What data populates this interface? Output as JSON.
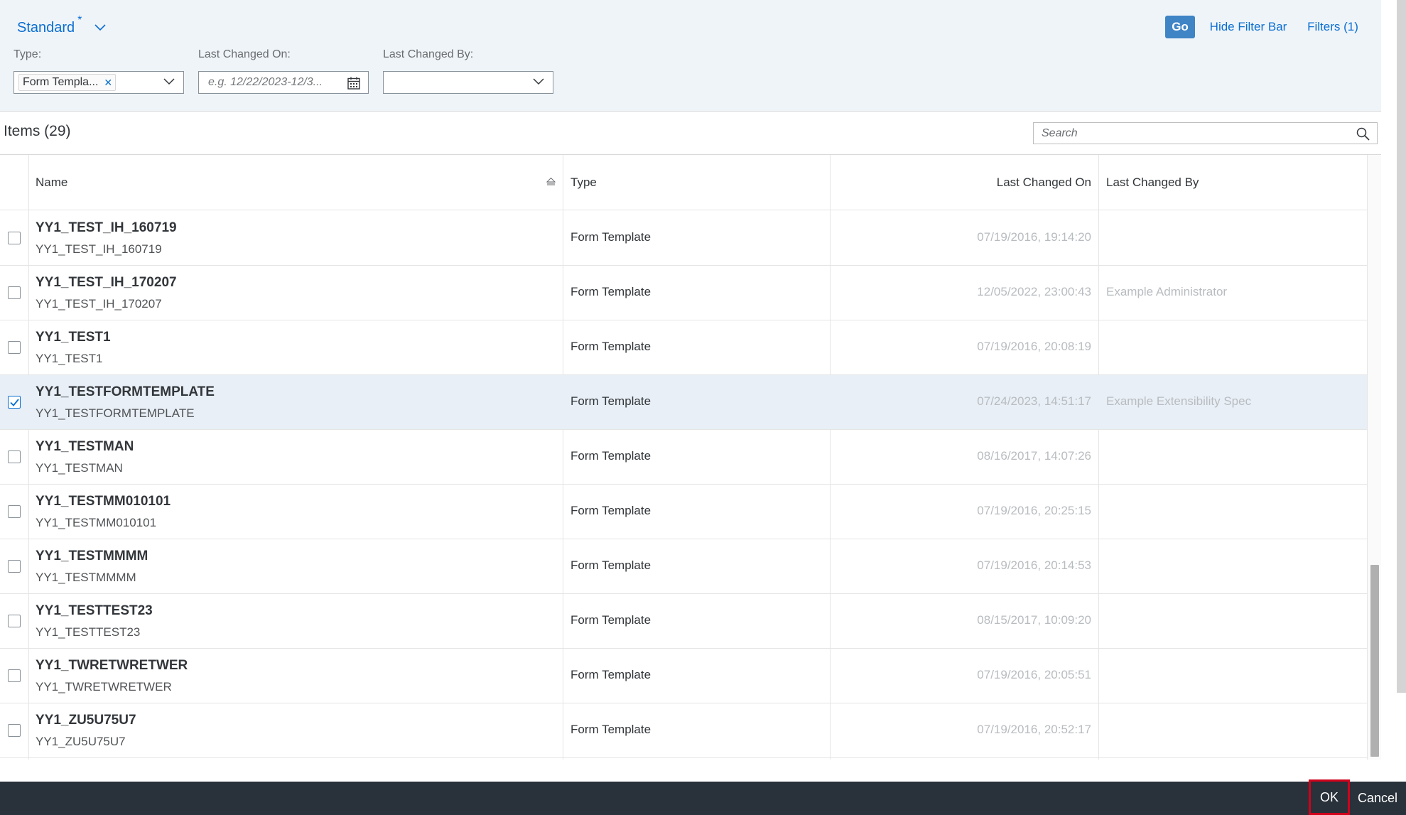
{
  "filter_bar": {
    "variant_title": "Standard",
    "variant_modified_marker": "*",
    "go_label": "Go",
    "hide_filter_bar_label": "Hide Filter Bar",
    "filters_label": "Filters (1)",
    "type_label": "Type:",
    "type_token": "Form Templa...",
    "last_changed_on_label": "Last Changed On:",
    "last_changed_on_placeholder": "e.g. 12/22/2023-12/3...",
    "last_changed_by_label": "Last Changed By:",
    "last_changed_by_value": ""
  },
  "items": {
    "title": "Items (29)",
    "search_placeholder": "Search"
  },
  "table": {
    "columns": {
      "name": "Name",
      "type": "Type",
      "last_changed_on": "Last Changed On",
      "last_changed_by": "Last Changed By"
    },
    "rows": [
      {
        "title": "YY1_TEST_IH_160719",
        "subtitle": "YY1_TEST_IH_160719",
        "type": "Form Template",
        "last_changed_on": "07/19/2016, 19:14:20",
        "last_changed_by": "",
        "selected": false
      },
      {
        "title": "YY1_TEST_IH_170207",
        "subtitle": "YY1_TEST_IH_170207",
        "type": "Form Template",
        "last_changed_on": "12/05/2022, 23:00:43",
        "last_changed_by": "Example Administrator",
        "selected": false
      },
      {
        "title": "YY1_TEST1",
        "subtitle": "YY1_TEST1",
        "type": "Form Template",
        "last_changed_on": "07/19/2016, 20:08:19",
        "last_changed_by": "",
        "selected": false
      },
      {
        "title": "YY1_TESTFORMTEMPLATE",
        "subtitle": "YY1_TESTFORMTEMPLATE",
        "type": "Form Template",
        "last_changed_on": "07/24/2023, 14:51:17",
        "last_changed_by": "Example Extensibility Spec",
        "selected": true
      },
      {
        "title": "YY1_TESTMAN",
        "subtitle": "YY1_TESTMAN",
        "type": "Form Template",
        "last_changed_on": "08/16/2017, 14:07:26",
        "last_changed_by": "",
        "selected": false
      },
      {
        "title": "YY1_TESTMM010101",
        "subtitle": "YY1_TESTMM010101",
        "type": "Form Template",
        "last_changed_on": "07/19/2016, 20:25:15",
        "last_changed_by": "",
        "selected": false
      },
      {
        "title": "YY1_TESTMMMM",
        "subtitle": "YY1_TESTMMMM",
        "type": "Form Template",
        "last_changed_on": "07/19/2016, 20:14:53",
        "last_changed_by": "",
        "selected": false
      },
      {
        "title": "YY1_TESTTEST23",
        "subtitle": "YY1_TESTTEST23",
        "type": "Form Template",
        "last_changed_on": "08/15/2017, 10:09:20",
        "last_changed_by": "",
        "selected": false
      },
      {
        "title": "YY1_TWRETWRETWER",
        "subtitle": "YY1_TWRETWRETWER",
        "type": "Form Template",
        "last_changed_on": "07/19/2016, 20:05:51",
        "last_changed_by": "",
        "selected": false
      },
      {
        "title": "YY1_ZU5U75U7",
        "subtitle": "YY1_ZU5U75U7",
        "type": "Form Template",
        "last_changed_on": "07/19/2016, 20:52:17",
        "last_changed_by": "",
        "selected": false
      }
    ]
  },
  "footer": {
    "ok_label": "OK",
    "cancel_label": "Cancel"
  },
  "colors": {
    "accent": "#0a6ed1",
    "go_button": "#3f84c5",
    "footer_bg": "#29313a",
    "ok_highlight": "#d0021b",
    "filter_bar_bg": "#eff4f9",
    "selected_row_bg": "#e8eff6"
  },
  "icons": {
    "variant": "chevron-down-icon",
    "token_remove": "close-icon",
    "date_picker": "calendar-icon",
    "search": "search-icon",
    "sort": "sort-ascending-icon",
    "checkbox_checked": "checkmark-icon"
  }
}
